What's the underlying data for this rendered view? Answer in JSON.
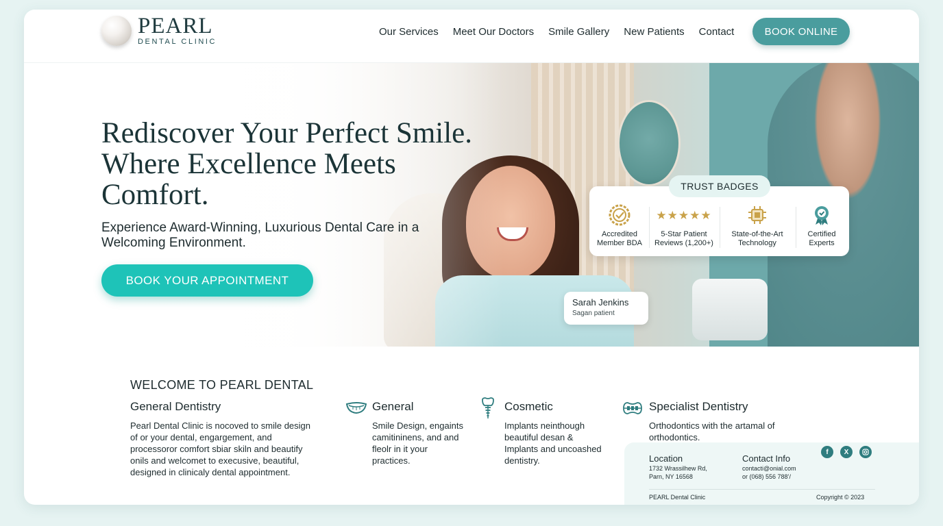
{
  "brand": {
    "name": "PEARL",
    "tagline": "DENTAL CLINIC"
  },
  "nav": {
    "items": [
      "Our Services",
      "Meet Our Doctors",
      "Smile Gallery",
      "New Patients",
      "Contact"
    ],
    "cta": "BOOK ONLINE"
  },
  "hero": {
    "headline_lines": [
      "Rediscover Your Perfect Smile.",
      "Where Excellence Meets",
      "Comfort."
    ],
    "subhead": "Experience Award-Winning, Luxurious Dental Care in a Welcoming Environment.",
    "cta": "BOOK YOUR APPOINTMENT"
  },
  "trust": {
    "title": "TRUST BADGES",
    "badges": [
      {
        "icon": "award-seal-icon",
        "label": "Accredited Member BDA"
      },
      {
        "icon": "five-stars-icon",
        "label": "5-Star Patient Reviews (1,200+)"
      },
      {
        "icon": "chip-technology-icon",
        "label": "State-of-the-Art Technology"
      },
      {
        "icon": "ribbon-award-icon",
        "label": "Certified Experts"
      }
    ]
  },
  "testimonial": {
    "name": "Sarah Jenkins",
    "role": "Sagan patient"
  },
  "welcome": {
    "title": "WELCOME TO PEARL DENTAL",
    "columns": [
      {
        "title": "General Dentistry",
        "text": "Pearl Dental Clinic is nocoved to smile design of or your dental, engargement, and processoror comfort sbiar skiln and beautify onils and welcomet to execusive, beautiful, designed in clinicaly dental appointment.",
        "icon": ""
      },
      {
        "title": "General",
        "text": "Smile Design, engaints camitininens, and and fleolr in it your practices.",
        "icon": "smile-mouth-icon"
      },
      {
        "title": "Cosmetic",
        "text": "Implants neinthough beautiful desan & Implants and uncoashed dentistry.",
        "icon": "tooth-implant-icon"
      },
      {
        "title": "Specialist Dentistry",
        "text": "Orthodontics with the artamal of orthodontics.",
        "icon": "braces-icon"
      }
    ]
  },
  "footer": {
    "location_label": "Location",
    "address_line1": "1732 Wrassilhew Rd,",
    "address_line2": "Parn, NY 16568",
    "contact_label": "Contact Info",
    "email": "contacti@onial.com",
    "phone": "or (068) 556 788’/",
    "clinic": "PEARL Dental Clinic",
    "copyright": "Copyright © 2023",
    "social": [
      "facebook-icon",
      "x-icon",
      "instagram-icon"
    ]
  },
  "colors": {
    "accent": "#1ec3b8",
    "brand_teal": "#4a9d9e",
    "dark_text": "#1d2b2e",
    "gold": "#c9a24a"
  }
}
